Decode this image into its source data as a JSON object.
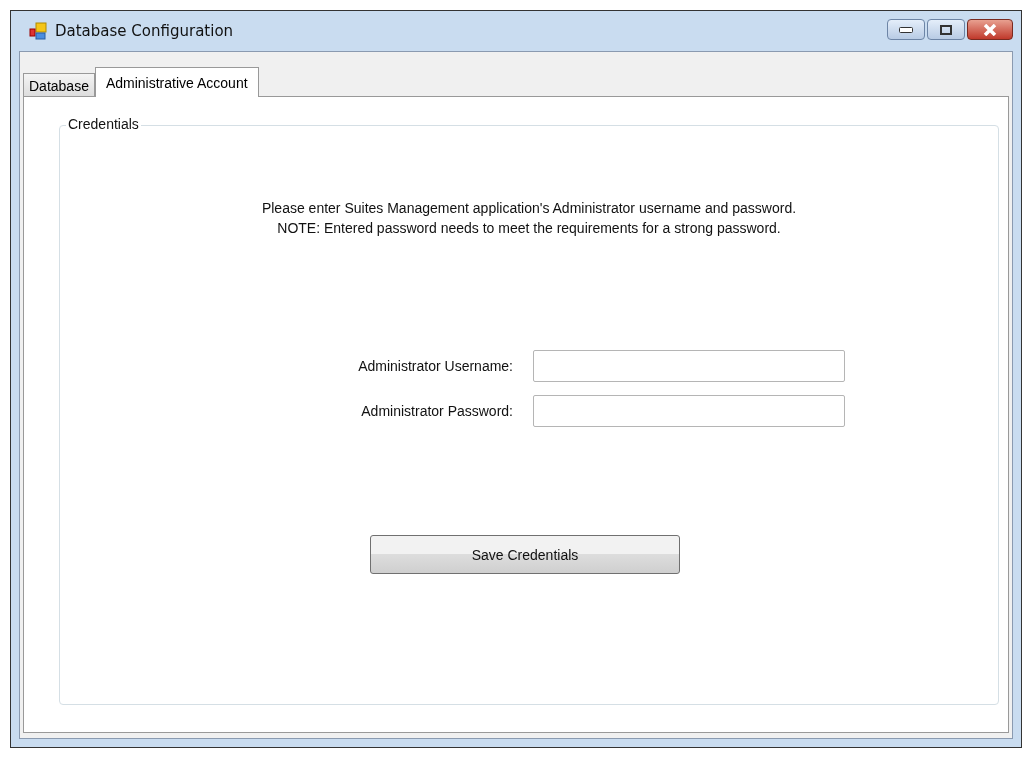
{
  "window": {
    "title": "Database Configuration"
  },
  "tabs": [
    {
      "label": "Database",
      "selected": false
    },
    {
      "label": "Administrative Account",
      "selected": true
    }
  ],
  "group": {
    "title": "Credentials"
  },
  "message": [
    "Please enter Suites Management application's Administrator username and password.",
    "NOTE: Entered password needs to meet the requirements for a strong password."
  ],
  "fields": [
    {
      "label": "Administrator Username:"
    },
    {
      "label": "Administrator Password:"
    }
  ],
  "buttons": [
    "Save Credentials"
  ]
}
